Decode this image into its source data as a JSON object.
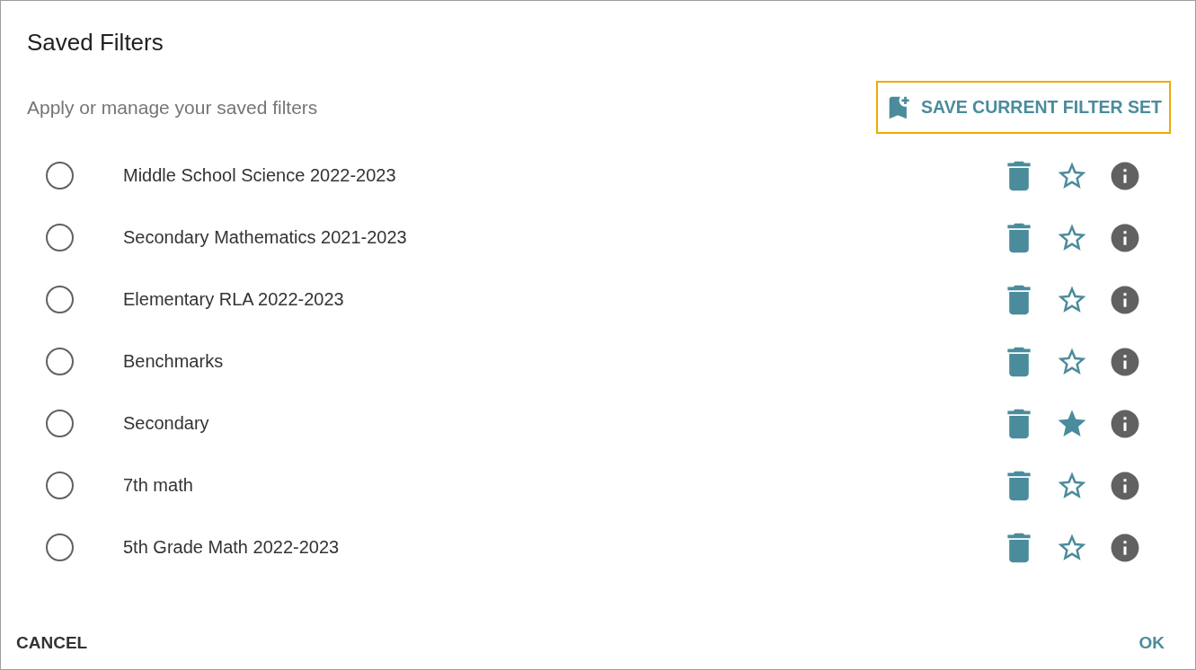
{
  "dialog": {
    "title": "Saved Filters",
    "subtitle": "Apply or manage your saved filters",
    "save_button": "SAVE CURRENT FILTER SET",
    "filters": [
      {
        "name": "Middle School Science 2022-2023",
        "selected": false,
        "favorite": false
      },
      {
        "name": "Secondary Mathematics 2021-2023",
        "selected": false,
        "favorite": false
      },
      {
        "name": "Elementary RLA 2022-2023",
        "selected": false,
        "favorite": false
      },
      {
        "name": "Benchmarks",
        "selected": false,
        "favorite": false
      },
      {
        "name": "Secondary",
        "selected": false,
        "favorite": true
      },
      {
        "name": "7th math",
        "selected": false,
        "favorite": false
      },
      {
        "name": "5th Grade Math 2022-2023",
        "selected": false,
        "favorite": false
      }
    ],
    "buttons": [
      "CANCEL",
      "OK"
    ]
  }
}
